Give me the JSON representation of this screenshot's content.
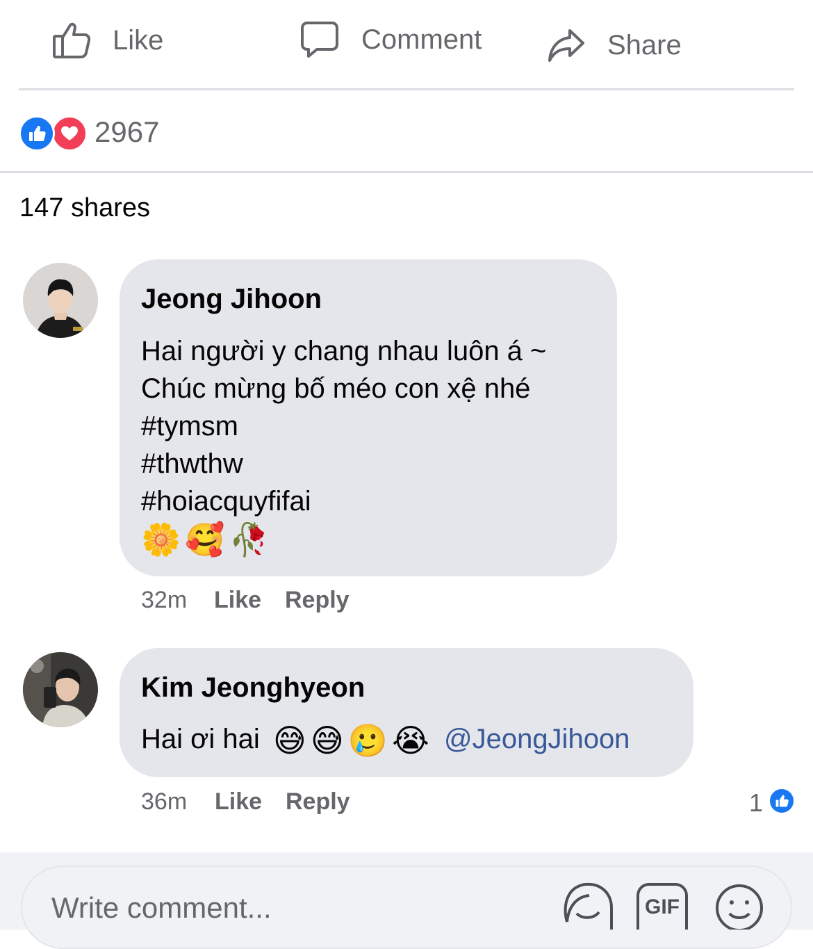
{
  "actions": {
    "like_label": "Like",
    "comment_label": "Comment",
    "share_label": "Share"
  },
  "reactions": {
    "count": "2967",
    "icons": [
      "like-icon",
      "love-icon"
    ],
    "colors": {
      "like": "#1877f2",
      "love": "#f33e58"
    }
  },
  "shares": {
    "label": "147 shares"
  },
  "comments": [
    {
      "author": "Jeong Jihoon",
      "lines": [
        "Hai người y chang nhau luôn á ~",
        "Chúc mừng bố méo con xệ nhé",
        "#tymsm",
        "#thwthw",
        "#hoiacquyfifai"
      ],
      "emojis": [
        "🌼",
        "🥰",
        "🥀"
      ],
      "time": "32m",
      "like_label": "Like",
      "reply_label": "Reply"
    },
    {
      "author": "Kim Jeonghyeon",
      "text": "Hai ơi hai",
      "emojis": [
        "😅",
        "😅",
        "🥲",
        "😭"
      ],
      "mention": "@JeongJihoon",
      "time": "36m",
      "like_label": "Like",
      "reply_label": "Reply",
      "reaction_count": "1"
    }
  ],
  "composer": {
    "placeholder": "Write comment...",
    "tools": [
      "sticker-icon",
      "gif-icon",
      "emoji-icon"
    ],
    "gif_text": "GIF"
  },
  "colors": {
    "accent": "#1877f2",
    "mention": "#385898",
    "secondary_text": "#65676b",
    "bubble": "#e4e6eb"
  }
}
